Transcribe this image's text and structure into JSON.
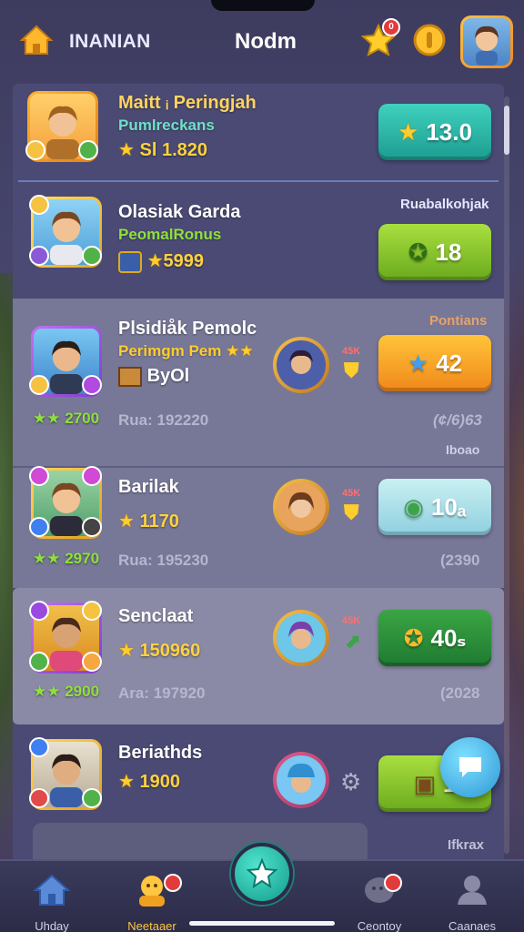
{
  "header": {
    "app_name": "INANIAN",
    "title": "Nodm",
    "star_badge": "0"
  },
  "rows": [
    {
      "name": "Maitt ᵢ Peringjah",
      "sub": "Pumlreckans",
      "stat": "Sl 1.820",
      "button": "13.0",
      "button_style": "teal",
      "tag": ""
    },
    {
      "name": "Olasiak Garda",
      "sub": "PeomalRonus",
      "stat": "5999",
      "button": "18",
      "button_style": "green",
      "tag": "Ruabalkohjak"
    },
    {
      "name": "Plsidiåk Pemolc",
      "sub": "Perimgm Pem",
      "extra": "ByOl",
      "green_stat": "2700",
      "grey_left": "Rua: 192220",
      "grey_right": "(¢/6)63",
      "level": "45K",
      "button": "42",
      "button_style": "orange",
      "tag": "Pontians",
      "tag2": "Iboao"
    },
    {
      "name": "Barilak",
      "stat": "1170",
      "green_stat": "2970",
      "grey_left": "Rua: 195230",
      "grey_right": "(2390",
      "level": "45K",
      "button": "10ₐ",
      "button_style": "pale"
    },
    {
      "name": "Senclaat",
      "stat": "150960",
      "green_stat": "2900",
      "grey_left": "Ara: 197920",
      "grey_right": "(2028",
      "level": "45K",
      "button": "40ₛ",
      "button_style": "dgreen"
    },
    {
      "name": "Beriathds",
      "stat": "1900",
      "button": "1",
      "button_style": "green",
      "tag": "Ifkrax"
    }
  ],
  "nav": [
    {
      "label": "Uhday",
      "icon": "home-icon"
    },
    {
      "label": "Neetaaer",
      "icon": "character-icon",
      "active": true
    },
    {
      "label": "",
      "icon": "star-icon"
    },
    {
      "label": "Ceontoy",
      "icon": "chat-icon"
    },
    {
      "label": "Caanaes",
      "icon": "profile-icon"
    }
  ],
  "colors": {
    "accent": "#ffc640",
    "panel": "#4c4c76",
    "teal": "#1d9c91"
  }
}
